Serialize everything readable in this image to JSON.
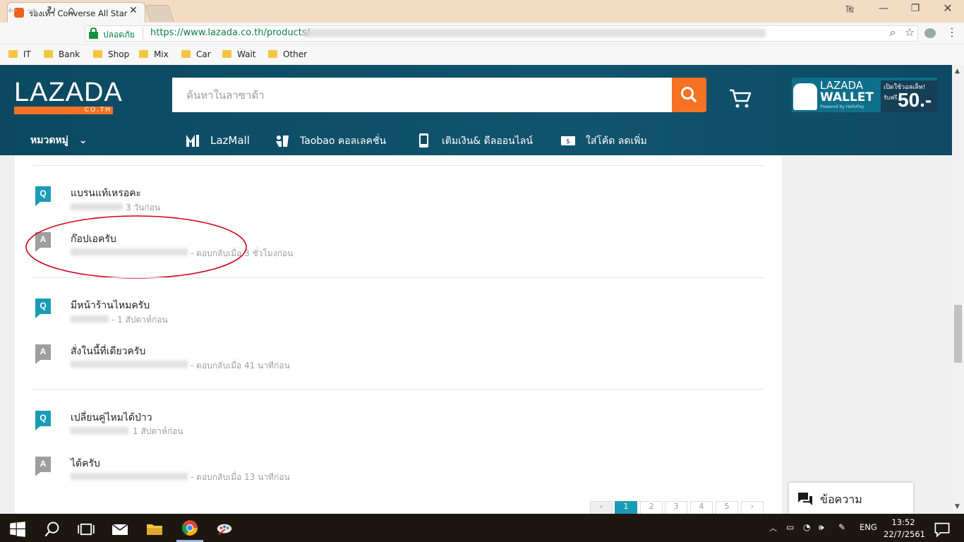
{
  "browser": {
    "tab_title": "รองเท้า Converse All Star",
    "secure_label": "ปลอดภัย",
    "url": "https://www.lazada.co.th/products/",
    "bookmarks": [
      "IT",
      "Bank",
      "Shop",
      "Mix",
      "Car",
      "Wait",
      "Other"
    ]
  },
  "header": {
    "logo": "LAZADA",
    "logo_sub": "CO.TH",
    "search_placeholder": "ค้นหาในลาซาด้า",
    "wallet": {
      "line1": "LAZADA",
      "line2": "WALLET",
      "line3": "Powered by HelloPay",
      "promo1": "เปิดใช้วอลเล็ท!",
      "promo2": "รับฟรี",
      "promo_amount": "50.-"
    },
    "nav": {
      "categories": "หมวดหมู่",
      "lazmall": "LazMall",
      "taobao": "Taobao คอลเลคชั่น",
      "topup": "เติมเงิน& ดีลออนไลน์",
      "voucher": "ใส่โค้ด ลดเพิ่ม"
    }
  },
  "qa": [
    {
      "q": "แบรนแท้เหรอคะ",
      "q_meta": "3 วันก่อน",
      "a": "ก๊อปเอครับ",
      "a_meta": "- ตอบกลับเมื่อ 3 ชั่วโมงก่อน"
    },
    {
      "q": "มีหน้าร้านไหมครับ",
      "q_meta": "- 1 สัปดาห์ก่อน",
      "a": "สั่งในนี้ที่เดียวครับ",
      "a_meta": "- ตอบกลับเมื่อ 41 นาทีก่อน"
    },
    {
      "q": "เปลี่ยนคู่ไหมได้ป่าว",
      "q_meta": "1 สัปดาห์ก่อน",
      "a": "ได้ครับ",
      "a_meta": "- ตอบกลับเมื่อ 13 นาทีก่อน"
    }
  ],
  "badges": {
    "q": "Q",
    "a": "A"
  },
  "pagination": [
    "‹",
    "1",
    "2",
    "3",
    "4",
    "5",
    "›"
  ],
  "pagination_current": "1",
  "chat_label": "ข้อความ",
  "taskbar": {
    "lang": "ENG",
    "time": "13:52",
    "date": "22/7/2561"
  },
  "colors": {
    "lazada_header": "#0f4a64",
    "accent_orange": "#f57224",
    "badge_q": "#1a9cb7",
    "badge_a": "#9e9e9e",
    "annotation_circle": "#d0021b"
  },
  "icons": {
    "search": "magnifier",
    "cart": "shopping-cart",
    "chat": "chat-bubbles"
  }
}
